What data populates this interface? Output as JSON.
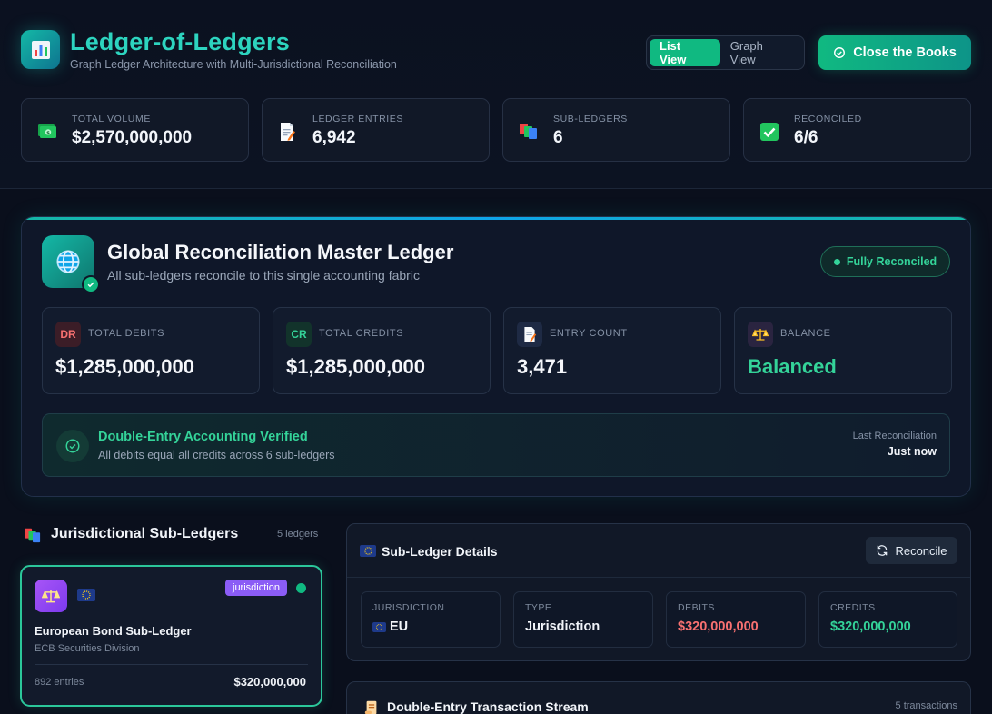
{
  "app": {
    "title": "Ledger-of-Ledgers",
    "subtitle": "Graph Ledger Architecture with Multi-Jurisdictional Reconciliation"
  },
  "view_toggle": {
    "list_label": "List View",
    "graph_label": "Graph View",
    "active": "list"
  },
  "close_books_label": "Close the Books",
  "stats": [
    {
      "label": "TOTAL VOLUME",
      "value": "$2,570,000,000",
      "icon": "money-icon"
    },
    {
      "label": "LEDGER ENTRIES",
      "value": "6,942",
      "icon": "memo-icon"
    },
    {
      "label": "SUB-LEDGERS",
      "value": "6",
      "icon": "books-icon"
    },
    {
      "label": "RECONCILED",
      "value": "6/6",
      "icon": "check-box-icon"
    }
  ],
  "master": {
    "title": "Global Reconciliation Master Ledger",
    "subtitle": "All sub-ledgers reconcile to this single accounting fabric",
    "status": "Fully Reconciled",
    "cards": [
      {
        "badge": "DR",
        "label": "TOTAL DEBITS",
        "value": "$1,285,000,000"
      },
      {
        "badge": "CR",
        "label": "TOTAL CREDITS",
        "value": "$1,285,000,000"
      },
      {
        "badge": "",
        "label": "ENTRY COUNT",
        "value": "3,471"
      },
      {
        "badge": "",
        "label": "BALANCE",
        "value": "Balanced"
      }
    ],
    "verification": {
      "title": "Double-Entry Accounting Verified",
      "subtitle": "All debits equal all credits across 6 sub-ledgers",
      "last_label": "Last Reconciliation",
      "last_value": "Just now"
    }
  },
  "sub_ledgers": {
    "title": "Jurisdictional Sub-Ledgers",
    "count_label": "5 ledgers",
    "items": [
      {
        "name": "European Bond Sub-Ledger",
        "division": "ECB Securities Division",
        "tag": "jurisdiction",
        "entries": "892 entries",
        "amount": "$320,000,000"
      }
    ]
  },
  "details": {
    "title": "Sub-Ledger Details",
    "reconcile_label": "Reconcile",
    "fields": [
      {
        "label": "JURISDICTION",
        "value": "EU"
      },
      {
        "label": "TYPE",
        "value": "Jurisdiction"
      },
      {
        "label": "DEBITS",
        "value": "$320,000,000"
      },
      {
        "label": "CREDITS",
        "value": "$320,000,000"
      }
    ]
  },
  "stream": {
    "title": "Double-Entry Transaction Stream",
    "count_label": "5 transactions"
  },
  "colors": {
    "accent": "#2dd4bf",
    "success": "#34d399",
    "debit": "#f87171",
    "credit": "#34d399",
    "purple": "#8b5cf6"
  }
}
